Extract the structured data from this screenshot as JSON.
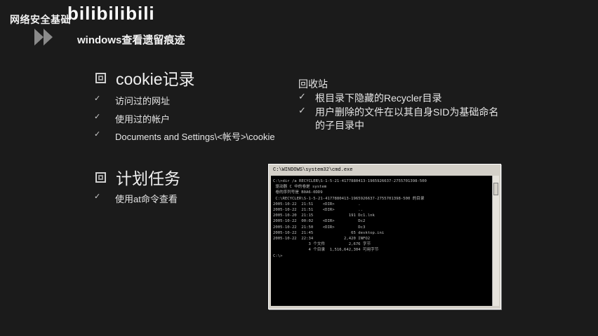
{
  "header": {
    "course": "网络安全基础",
    "logo": "bilibilibili",
    "subtitle": "windows查看遗留痕迹"
  },
  "left": {
    "section1": {
      "title": "cookie记录",
      "items": [
        "访问过的网址",
        "使用过的帐户",
        "Documents and Settings\\<帐号>\\cookie"
      ]
    },
    "section2": {
      "title": "计划任务",
      "items": [
        "使用at命令查看"
      ]
    }
  },
  "right": {
    "title": "回收站",
    "items": [
      "根目录下隐藏的Recycler目录",
      "用户删除的文件在以其自身SID为基础命名",
      "的子目录中"
    ]
  },
  "check_mark": "✓",
  "cmd": {
    "title": "C:\\WINDOWS\\system32\\cmd.exe",
    "lines": [
      "C:\\>dir /a RECYCLER\\S-1-5-21-4177880413-1965926637-2755701398-500",
      " 驱动器 C 中的卷是 system",
      " 卷的序列号是 B0A6-0DD9",
      "",
      " C:\\RECYCLER\\S-1-5-21-4177880413-1965926637-2755701398-500 的目录",
      "",
      "2005-10-22  21:51    <DIR>          .",
      "2005-10-22  21:51    <DIR>          ..",
      "2005-10-20  21:15               191 Dc1.lnk",
      "2005-10-22  00:02    <DIR>          Dc2",
      "2005-10-22  21:50    <DIR>          Dc3",
      "2005-10-22  21:45                65 desktop.ini",
      "2005-10-22  22:34             2,420 INFO2",
      "               3 个文件          2,676 字节",
      "               4 个目录  1,516,642,304 可用字节",
      "",
      "C:\\>"
    ]
  }
}
